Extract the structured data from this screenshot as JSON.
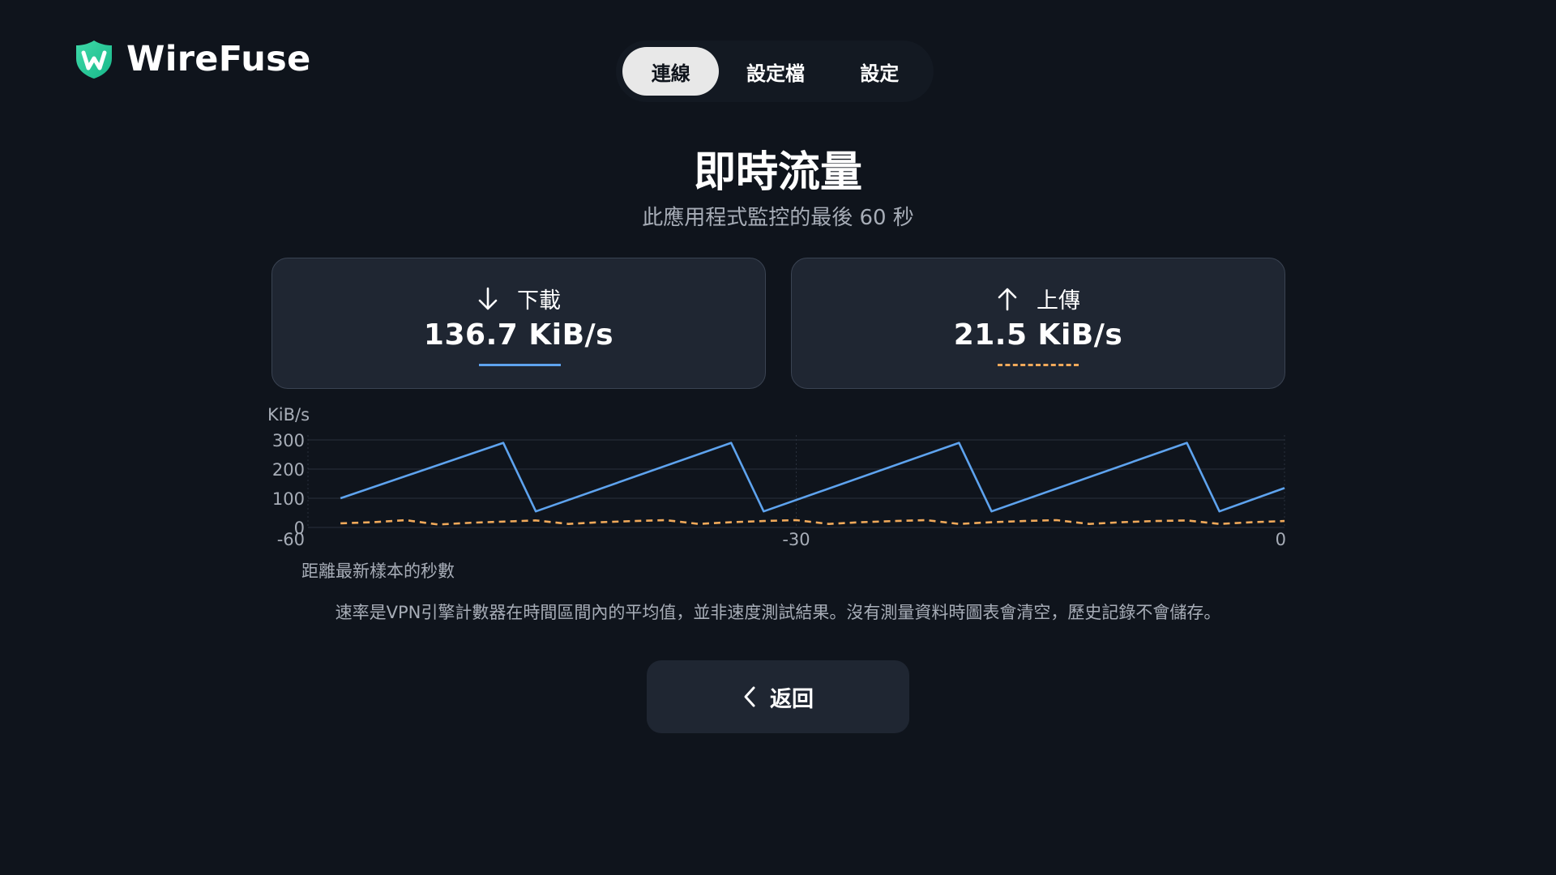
{
  "app": {
    "name": "WireFuse",
    "logo_icon": "shield-w-logo"
  },
  "tabs": [
    {
      "label": "連線",
      "active": true
    },
    {
      "label": "設定檔",
      "active": false
    },
    {
      "label": "設定",
      "active": false
    }
  ],
  "header": {
    "title": "即時流量",
    "subtitle": "此應用程式監控的最後 60 秒"
  },
  "download": {
    "label": "下載",
    "value": "136.7 KiB/s",
    "icon": "arrow-down-icon",
    "color": "#5ea3ee"
  },
  "upload": {
    "label": "上傳",
    "value": "21.5 KiB/s",
    "icon": "arrow-up-icon",
    "color": "#f0a95a"
  },
  "chart_data": {
    "type": "line",
    "ylabel": "KiB/s",
    "xlabel": "距離最新樣本的秒數",
    "xlim": [
      -60,
      0
    ],
    "ylim": [
      0,
      300
    ],
    "yticks": [
      0,
      100,
      200,
      300
    ],
    "xticks": [
      -60,
      -30,
      0
    ],
    "grid": true,
    "series": [
      {
        "style": "solid",
        "color": "#5ea3ee",
        "x": [
          -58,
          -48,
          -46,
          -34,
          -32,
          -20,
          -18,
          -6,
          -4,
          0
        ],
        "y": [
          100,
          290,
          55,
          290,
          55,
          290,
          55,
          290,
          55,
          135
        ]
      },
      {
        "style": "dashed",
        "color": "#f0a95a",
        "x": [
          -58,
          -56,
          -54,
          -52,
          -50,
          -48,
          -46,
          -44,
          -42,
          -40,
          -38,
          -36,
          -34,
          -32,
          -30,
          -28,
          -26,
          -24,
          -22,
          -20,
          -18,
          -16,
          -14,
          -12,
          -10,
          -8,
          -6,
          -4,
          -2,
          0
        ],
        "y": [
          14,
          18,
          25,
          10,
          16,
          20,
          24,
          12,
          18,
          22,
          25,
          12,
          18,
          22,
          25,
          12,
          18,
          22,
          25,
          12,
          18,
          22,
          25,
          12,
          18,
          22,
          24,
          12,
          18,
          22
        ]
      }
    ]
  },
  "footnote": "速率是VPN引擎計數器在時間區間內的平均值，並非速度測試結果。沒有測量資料時圖表會清空，歷史記錄不會儲存。",
  "back_button": {
    "label": "返回",
    "icon": "chevron-left-icon"
  }
}
